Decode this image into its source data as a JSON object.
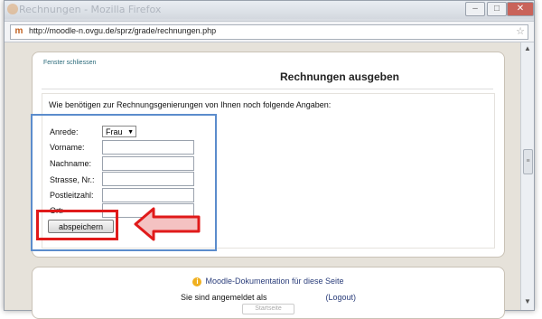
{
  "window": {
    "title": "Rechnungen - Mozilla Firefox",
    "minimize": "–",
    "maximize": "□",
    "close": "✕"
  },
  "urlbar": {
    "url": "http://moodle-n.ovgu.de/sprz/grade/rechnungen.php",
    "site_icon": "m",
    "bookmark_icon": "☆"
  },
  "page": {
    "close_link": "Fenster schliessen",
    "title": "Rechnungen ausgeben",
    "intro": "Wie benötigen zur Rechnungsgenierungen von Ihnen noch folgende Angaben:",
    "form": {
      "anrede_label": "Anrede:",
      "anrede_value": "Frau",
      "vorname_label": "Vorname:",
      "nachname_label": "Nachname:",
      "strasse_label": "Strasse, Nr.:",
      "plz_label": "Postleitzahl:",
      "ort_label": "Ort:",
      "save_label": "abspeichern"
    }
  },
  "footer": {
    "docs_link": "Moodle-Dokumentation für diese Seite",
    "logged_in_prefix": "Sie sind angemeldet als",
    "logout_label": "(Logout)",
    "home_button": "Startseite"
  },
  "colors": {
    "annotation_blue": "#5b8ccc",
    "annotation_red": "#e01a1a"
  }
}
